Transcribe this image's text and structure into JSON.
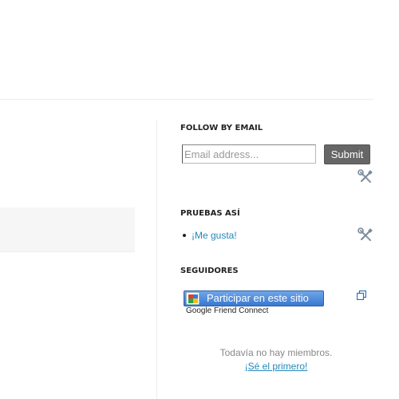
{
  "follow_by_email": {
    "title": "FOLLOW BY EMAIL",
    "email_placeholder": "Email address...",
    "submit_label": "Submit"
  },
  "pruebas": {
    "title": "PRUEBAS ASÍ",
    "items": [
      {
        "label": "¡Me gusta!"
      }
    ]
  },
  "seguidores": {
    "title": "SEGUIDORES",
    "join_button_label": "Participar en este sitio",
    "provider_caption": "Google Friend Connect",
    "no_members_text": "Todavía no hay miembros.",
    "be_first_link": "¡Sé el primero!"
  },
  "icons": {
    "edit": "wrench-screwdriver-icon",
    "popout": "popout-window-icon"
  },
  "colors": {
    "link": "#2288bb",
    "submit_bg": "#666666",
    "join_button": "#3a78d0"
  }
}
